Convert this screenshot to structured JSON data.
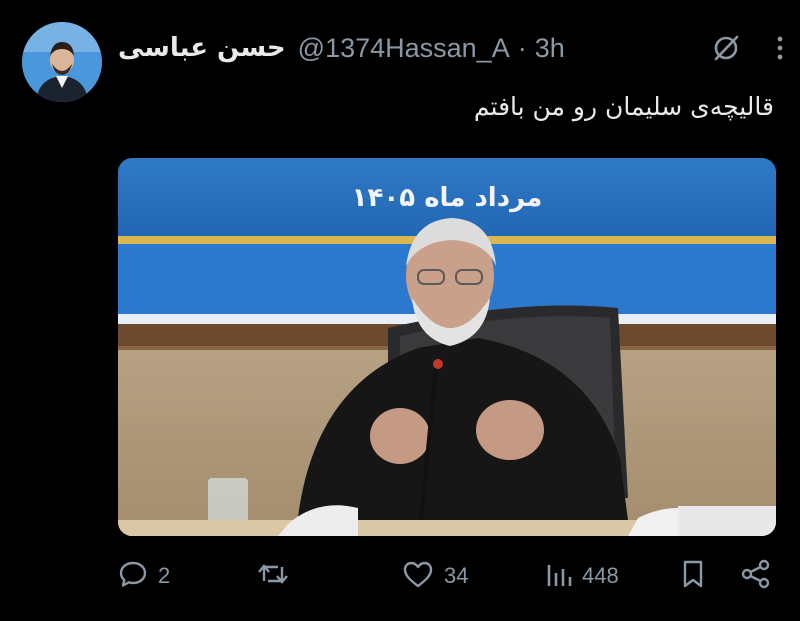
{
  "tweet": {
    "author_name": "حسن عباسی",
    "handle": "@1374Hassan_A",
    "separator": "·",
    "time": "3h",
    "text": "قالیچه‌ی سلیمان رو من بافتم"
  },
  "media": {
    "banner_text": "مرداد ماه ۱۴۰۵"
  },
  "actions": {
    "replies": "2",
    "retweets": "",
    "likes": "34",
    "views": "448"
  },
  "colors": {
    "background": "#000000",
    "text": "#e7e9ea",
    "muted": "#8b98a5",
    "banner_blue": "#2a6fbd"
  },
  "icons": [
    "grok-icon",
    "more-icon",
    "reply-icon",
    "retweet-icon",
    "like-icon",
    "views-icon",
    "bookmark-icon",
    "share-icon"
  ]
}
